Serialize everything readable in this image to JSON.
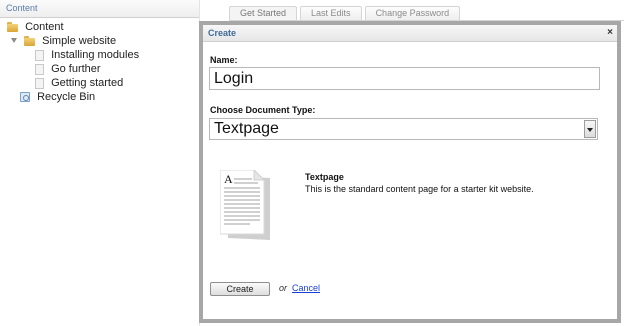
{
  "tree": {
    "header": "Content",
    "items": [
      {
        "label": "Content"
      },
      {
        "label": "Simple website"
      },
      {
        "label": "Installing modules"
      },
      {
        "label": "Go further"
      },
      {
        "label": "Getting started"
      },
      {
        "label": "Recycle Bin"
      }
    ]
  },
  "tabs": [
    {
      "label": "Get Started"
    },
    {
      "label": "Last Edits"
    },
    {
      "label": "Change Password"
    }
  ],
  "modal": {
    "title": "Create",
    "close_glyph": "×",
    "name_label": "Name:",
    "name_value": "Login",
    "doctype_label": "Choose Document Type:",
    "doctype_value": "Textpage",
    "doc_title": "Textpage",
    "doc_description": "This is the standard content page for a starter kit website.",
    "thumb_letter": "A",
    "create_label": "Create",
    "or_text": "or",
    "cancel_label": "Cancel"
  }
}
